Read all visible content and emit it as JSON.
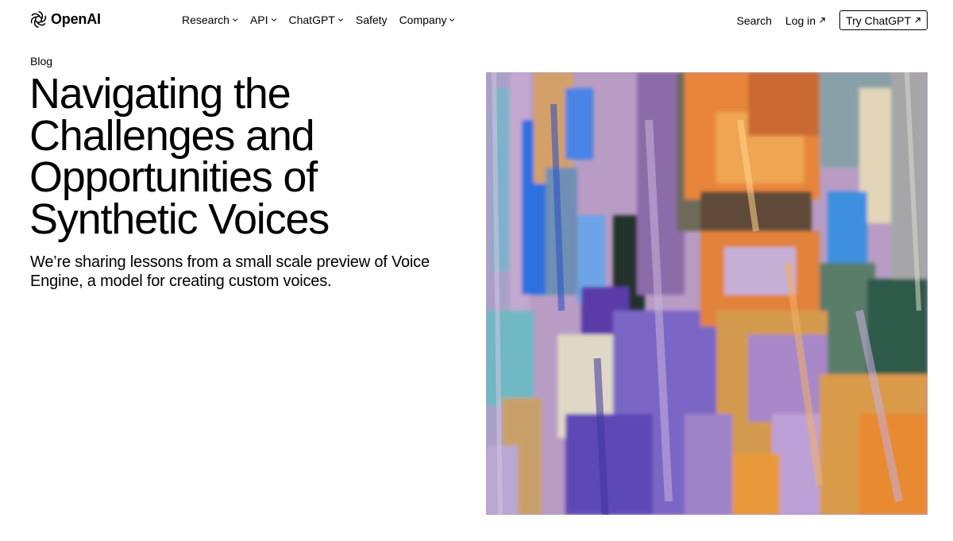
{
  "header": {
    "logo_text": "OpenAI",
    "logo_icon": "openai-knot-icon",
    "nav": [
      {
        "label": "Research",
        "has_dropdown": true
      },
      {
        "label": "API",
        "has_dropdown": true
      },
      {
        "label": "ChatGPT",
        "has_dropdown": true
      },
      {
        "label": "Safety",
        "has_dropdown": false
      },
      {
        "label": "Company",
        "has_dropdown": true
      }
    ],
    "search_label": "Search",
    "login_label": "Log in",
    "try_label": "Try ChatGPT"
  },
  "article": {
    "category": "Blog",
    "title": "Navigating the Challenges and Opportunities of Synthetic Voices",
    "subtitle": "We’re sharing lessons from a small scale preview of Voice Engine, a model for creating custom voices."
  },
  "hero_image": {
    "description": "abstract-painted-figure",
    "palette": [
      "#b99ac9",
      "#3a6fd8",
      "#e7863a",
      "#7a4ab8",
      "#6fb8c8",
      "#d9a552",
      "#2d3b2a"
    ]
  },
  "colors": {
    "text": "#000000",
    "background": "#ffffff"
  }
}
